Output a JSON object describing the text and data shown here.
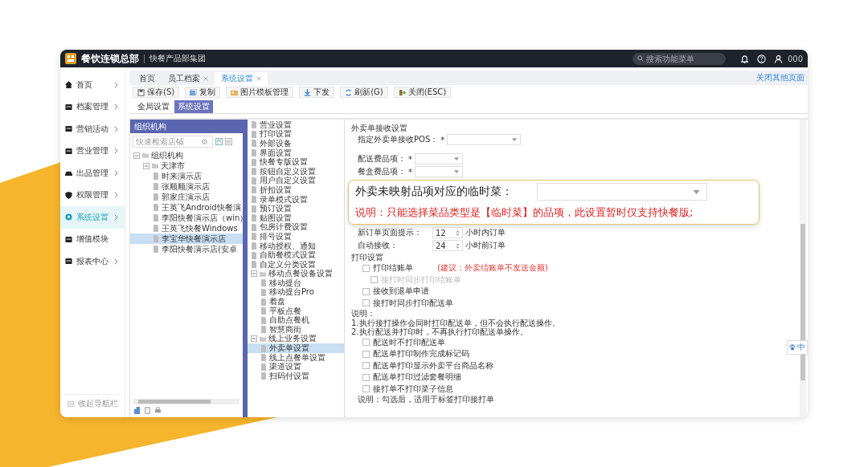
{
  "header": {
    "brand": "餐饮连锁总部",
    "org": "快餐产品部集团",
    "search": {
      "placeholder": "搜索功能菜单"
    },
    "user": "000"
  },
  "sidebar": {
    "items": [
      {
        "label": "首页",
        "has_submenu": true,
        "selected": false
      },
      {
        "label": "档案管理",
        "has_submenu": true,
        "selected": false
      },
      {
        "label": "营销活动",
        "has_submenu": true,
        "selected": false
      },
      {
        "label": "营业管理",
        "has_submenu": true,
        "selected": false
      },
      {
        "label": "出品管理",
        "has_submenu": true,
        "selected": false
      },
      {
        "label": "权限管理",
        "has_submenu": true,
        "selected": false
      },
      {
        "label": "系统设置",
        "has_submenu": true,
        "selected": true
      },
      {
        "label": "增值模块",
        "has_submenu": false,
        "selected": false
      },
      {
        "label": "报表中心",
        "has_submenu": true,
        "selected": false
      }
    ],
    "collapse": "收起导航栏"
  },
  "tabs": [
    {
      "label": "首页",
      "closable": false,
      "selected": false
    },
    {
      "label": "员工档案",
      "closable": true,
      "selected": false
    },
    {
      "label": "系统设置",
      "closable": true,
      "selected": true
    }
  ],
  "close_others": "关闭其他页面",
  "toolbar": [
    "保存(S)",
    "复制",
    "图片模板管理",
    "下发",
    "刷新(G)",
    "关闭(ESC)"
  ],
  "subtabs": [
    {
      "label": "全局设置",
      "selected": false
    },
    {
      "label": "系统设置",
      "selected": true
    }
  ],
  "org_panel": {
    "title": "组织机构",
    "search": {
      "placeholder": "快速检索店铺"
    },
    "tree": [
      {
        "label": "组织机构",
        "expanded": true,
        "selected": false,
        "children": [
          {
            "label": "天津市",
            "expanded": true,
            "selected": false,
            "children": [
              {
                "label": "时来演示店",
                "selected": false
              },
              {
                "label": "张顺顺演示店",
                "selected": false
              },
              {
                "label": "郭家庄演示店",
                "selected": false
              },
              {
                "label": "王英飞Android快餐演",
                "selected": false
              },
              {
                "label": "李阳快餐演示店（win）",
                "selected": false
              },
              {
                "label": "王英飞快餐Windows",
                "selected": false
              },
              {
                "label": "李宝华快餐演示店",
                "selected": true
              },
              {
                "label": "李阳快餐演示店(安卓",
                "selected": false
              }
            ]
          }
        ]
      }
    ]
  },
  "settings_tree": [
    {
      "label": "营业设置",
      "selected": false
    },
    {
      "label": "打印设置",
      "selected": false
    },
    {
      "label": "外部设备",
      "selected": false
    },
    {
      "label": "界面设置",
      "selected": false
    },
    {
      "label": "快餐专版设置",
      "selected": false
    },
    {
      "label": "按钮自定义设置",
      "selected": false
    },
    {
      "label": "用户自定义设置",
      "selected": false
    },
    {
      "label": "折扣设置",
      "selected": false
    },
    {
      "label": "录单模式设置",
      "selected": false
    },
    {
      "label": "预订设置",
      "selected": false
    },
    {
      "label": "贴图设置",
      "selected": false
    },
    {
      "label": "包房计费设置",
      "selected": false
    },
    {
      "label": "排号设置",
      "selected": false
    },
    {
      "label": "移动授权、通知",
      "selected": false
    },
    {
      "label": "自助餐模式设置",
      "selected": false
    },
    {
      "label": "自定义分类设置",
      "selected": false
    },
    {
      "label": "移动点餐设备设置",
      "expanded": true,
      "selected": false,
      "children": [
        {
          "label": "移动提台",
          "selected": false
        },
        {
          "label": "移动提台Pro",
          "selected": false
        },
        {
          "label": "着盘",
          "selected": false
        },
        {
          "label": "平板点餐",
          "selected": false
        },
        {
          "label": "自助点餐机",
          "selected": false
        },
        {
          "label": "智慧商街",
          "selected": false
        }
      ]
    },
    {
      "label": "线上业务设置",
      "expanded": true,
      "selected": false,
      "children": [
        {
          "label": "外卖单设置",
          "selected": true
        },
        {
          "label": "线上点餐单设置",
          "selected": false
        },
        {
          "label": "渠道设置",
          "selected": false
        },
        {
          "label": "扫码付设置",
          "selected": false
        }
      ]
    }
  ],
  "form": {
    "rows": [
      {
        "kind": "heading",
        "label": "外卖单接收设置"
      },
      {
        "kind": "select",
        "label": "指定外卖单接收POS：",
        "required_mark": "*"
      },
      {
        "kind": "gap"
      },
      {
        "kind": "select",
        "label": "配送费品项：",
        "required_mark": "*"
      },
      {
        "kind": "select",
        "label": "餐盒费品项：",
        "required_mark": "*"
      },
      {
        "kind": "covered"
      },
      {
        "kind": "spinner",
        "label": "新订单页面提示：",
        "value": "12",
        "unit": "小时内订单"
      },
      {
        "kind": "spinner",
        "label": "自动接收：",
        "value": "24",
        "unit": "小时前订单"
      },
      {
        "kind": "heading",
        "label": "打印设置"
      },
      {
        "kind": "checkbox",
        "label": "打印结账单",
        "checked": false,
        "disabled": false,
        "hint": "(建议：外卖结账单不发送金额)"
      },
      {
        "kind": "checkbox",
        "label": "接打时同步打印结账单",
        "checked": false,
        "disabled": true,
        "indent": true
      },
      {
        "kind": "checkbox",
        "label": "接收到退单申请",
        "checked": false,
        "disabled": false
      },
      {
        "kind": "checkbox",
        "label": "接打时同步打印配送单",
        "checked": false,
        "disabled": false
      },
      {
        "kind": "note",
        "label": "说明："
      },
      {
        "kind": "note",
        "label": "1.执行接打操作会同时打印配送单，但不会执行配送操作。"
      },
      {
        "kind": "note",
        "label": "2.执行配送并打印时，不再执行打印配送单操作。"
      },
      {
        "kind": "checkbox",
        "label": "配送时不打印配送单",
        "checked": false,
        "disabled": false
      },
      {
        "kind": "checkbox",
        "label": "配送单打印制作完成标记码",
        "checked": false,
        "disabled": false
      },
      {
        "kind": "checkbox",
        "label": "配送单打印显示外卖平台商品名称",
        "checked": false,
        "disabled": false
      },
      {
        "kind": "checkbox",
        "label": "配送单打印过滤套餐明细",
        "checked": false,
        "disabled": false
      },
      {
        "kind": "checkbox",
        "label": "接打单不打印菜子信息",
        "checked": false,
        "disabled": false
      },
      {
        "kind": "note",
        "label": "说明：勾选后，适用于标签打印接打单",
        "indent": true
      }
    ]
  },
  "callout": {
    "label": "外卖未映射品项对应的临时菜：",
    "note": "说明：只能选择菜品类型是【临时菜】的品项，此设置暂时仅支持快餐版;"
  },
  "ime": "中"
}
